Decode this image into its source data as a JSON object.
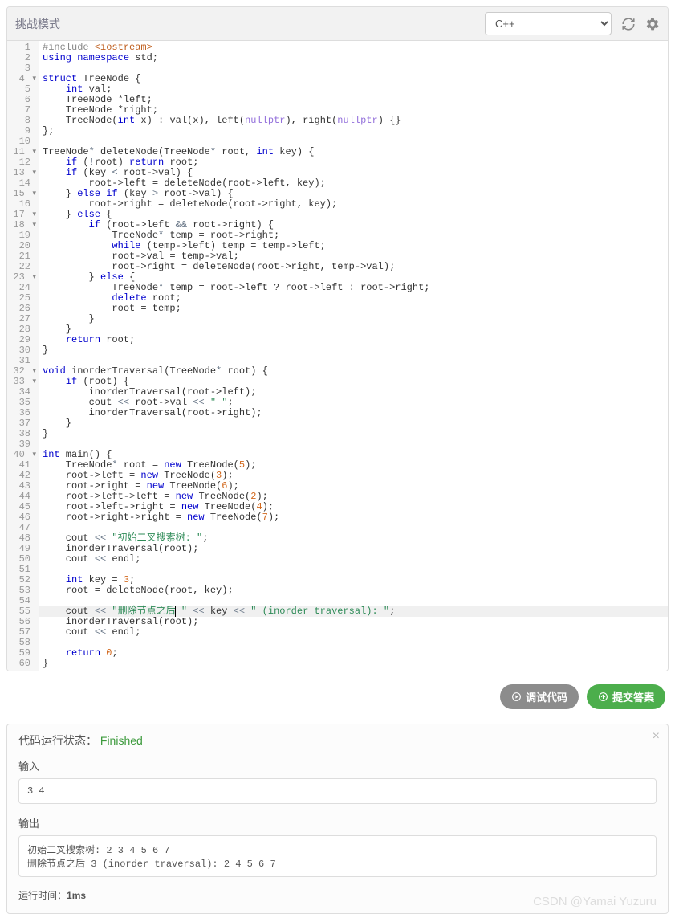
{
  "header": {
    "mode_label": "挑战模式",
    "language": "C++"
  },
  "gutter": {
    "fold_lines": [
      4,
      11,
      13,
      15,
      17,
      18,
      23,
      32,
      33,
      40
    ]
  },
  "code_lines": [
    {
      "n": 1,
      "html": "<span class='tok-pre'>#include </span><span class='tok-inc'>&lt;iostream&gt;</span>"
    },
    {
      "n": 2,
      "html": "<span class='tok-kw'>using</span> <span class='tok-kw'>namespace</span> std;"
    },
    {
      "n": 3,
      "html": ""
    },
    {
      "n": 4,
      "html": "<span class='tok-kw'>struct</span> TreeNode {"
    },
    {
      "n": 5,
      "html": "    <span class='tok-kw'>int</span> val;"
    },
    {
      "n": 6,
      "html": "    TreeNode *left;"
    },
    {
      "n": 7,
      "html": "    TreeNode *right;"
    },
    {
      "n": 8,
      "html": "    TreeNode(<span class='tok-kw'>int</span> x) : val(x), left(<span class='tok-const'>nullptr</span>), right(<span class='tok-const'>nullptr</span>) {}"
    },
    {
      "n": 9,
      "html": "};"
    },
    {
      "n": 10,
      "html": ""
    },
    {
      "n": 11,
      "html": "TreeNode<span class='tok-op'>*</span> deleteNode(TreeNode<span class='tok-op'>*</span> root, <span class='tok-kw'>int</span> key) {"
    },
    {
      "n": 12,
      "html": "    <span class='tok-kw'>if</span> (<span class='tok-op'>!</span>root) <span class='tok-kw'>return</span> root;"
    },
    {
      "n": 13,
      "html": "    <span class='tok-kw'>if</span> (key <span class='tok-op'>&lt;</span> root-&gt;val) {"
    },
    {
      "n": 14,
      "html": "        root-&gt;left = deleteNode(root-&gt;left, key);"
    },
    {
      "n": 15,
      "html": "    } <span class='tok-kw'>else</span> <span class='tok-kw'>if</span> (key <span class='tok-op'>&gt;</span> root-&gt;val) {"
    },
    {
      "n": 16,
      "html": "        root-&gt;right = deleteNode(root-&gt;right, key);"
    },
    {
      "n": 17,
      "html": "    } <span class='tok-kw'>else</span> {"
    },
    {
      "n": 18,
      "html": "        <span class='tok-kw'>if</span> (root-&gt;left <span class='tok-op'>&amp;&amp;</span> root-&gt;right) {"
    },
    {
      "n": 19,
      "html": "            TreeNode<span class='tok-op'>*</span> temp = root-&gt;right;"
    },
    {
      "n": 20,
      "html": "            <span class='tok-kw'>while</span> (temp-&gt;left) temp = temp-&gt;left;"
    },
    {
      "n": 21,
      "html": "            root-&gt;val = temp-&gt;val;"
    },
    {
      "n": 22,
      "html": "            root-&gt;right = deleteNode(root-&gt;right, temp-&gt;val);"
    },
    {
      "n": 23,
      "html": "        } <span class='tok-kw'>else</span> {"
    },
    {
      "n": 24,
      "html": "            TreeNode<span class='tok-op'>*</span> temp = root-&gt;left ? root-&gt;left : root-&gt;right;"
    },
    {
      "n": 25,
      "html": "            <span class='tok-kw'>delete</span> root;"
    },
    {
      "n": 26,
      "html": "            root = temp;"
    },
    {
      "n": 27,
      "html": "        }"
    },
    {
      "n": 28,
      "html": "    }"
    },
    {
      "n": 29,
      "html": "    <span class='tok-kw'>return</span> root;"
    },
    {
      "n": 30,
      "html": "}"
    },
    {
      "n": 31,
      "html": ""
    },
    {
      "n": 32,
      "html": "<span class='tok-kw'>void</span> inorderTraversal(TreeNode<span class='tok-op'>*</span> root) {"
    },
    {
      "n": 33,
      "html": "    <span class='tok-kw'>if</span> (root) {"
    },
    {
      "n": 34,
      "html": "        inorderTraversal(root-&gt;left);"
    },
    {
      "n": 35,
      "html": "        cout <span class='tok-op'>&lt;&lt;</span> root-&gt;val <span class='tok-op'>&lt;&lt;</span> <span class='tok-str'>\" \"</span>;"
    },
    {
      "n": 36,
      "html": "        inorderTraversal(root-&gt;right);"
    },
    {
      "n": 37,
      "html": "    }"
    },
    {
      "n": 38,
      "html": "}"
    },
    {
      "n": 39,
      "html": ""
    },
    {
      "n": 40,
      "html": "<span class='tok-kw'>int</span> main() {"
    },
    {
      "n": 41,
      "html": "    TreeNode<span class='tok-op'>*</span> root = <span class='tok-kw'>new</span> TreeNode(<span class='tok-num'>5</span>);"
    },
    {
      "n": 42,
      "html": "    root-&gt;left = <span class='tok-kw'>new</span> TreeNode(<span class='tok-num'>3</span>);"
    },
    {
      "n": 43,
      "html": "    root-&gt;right = <span class='tok-kw'>new</span> TreeNode(<span class='tok-num'>6</span>);"
    },
    {
      "n": 44,
      "html": "    root-&gt;left-&gt;left = <span class='tok-kw'>new</span> TreeNode(<span class='tok-num'>2</span>);"
    },
    {
      "n": 45,
      "html": "    root-&gt;left-&gt;right = <span class='tok-kw'>new</span> TreeNode(<span class='tok-num'>4</span>);"
    },
    {
      "n": 46,
      "html": "    root-&gt;right-&gt;right = <span class='tok-kw'>new</span> TreeNode(<span class='tok-num'>7</span>);"
    },
    {
      "n": 47,
      "html": ""
    },
    {
      "n": 48,
      "html": "    cout <span class='tok-op'>&lt;&lt;</span> <span class='tok-str'>\"初始二叉搜索树: \"</span>;"
    },
    {
      "n": 49,
      "html": "    inorderTraversal(root);"
    },
    {
      "n": 50,
      "html": "    cout <span class='tok-op'>&lt;&lt;</span> endl;"
    },
    {
      "n": 51,
      "html": ""
    },
    {
      "n": 52,
      "html": "    <span class='tok-kw'>int</span> key = <span class='tok-num'>3</span>;"
    },
    {
      "n": 53,
      "html": "    root = deleteNode(root, key);"
    },
    {
      "n": 54,
      "html": ""
    },
    {
      "n": 55,
      "hl": true,
      "html": "    cout <span class='tok-op'>&lt;&lt;</span> <span class='tok-str'>\"删除节点之后<span class='cursor'></span> \"</span> <span class='tok-op'>&lt;&lt;</span> key <span class='tok-op'>&lt;&lt;</span> <span class='tok-str'>\" (inorder traversal): \"</span>;"
    },
    {
      "n": 56,
      "html": "    inorderTraversal(root);"
    },
    {
      "n": 57,
      "html": "    cout <span class='tok-op'>&lt;&lt;</span> endl;"
    },
    {
      "n": 58,
      "html": ""
    },
    {
      "n": 59,
      "html": "    <span class='tok-kw'>return</span> <span class='tok-num'>0</span>;"
    },
    {
      "n": 60,
      "html": "}"
    }
  ],
  "actions": {
    "debug_label": "调试代码",
    "submit_label": "提交答案"
  },
  "result": {
    "status_label": "代码运行状态：",
    "status_value": "Finished",
    "input_label": "输入",
    "input_value": "3 4",
    "output_label": "输出",
    "output_value": "初始二叉搜索树: 2 3 4 5 6 7 \n删除节点之后 3 (inorder traversal): 2 4 5 6 7 ",
    "runtime_label": "运行时间：",
    "runtime_value": "1ms"
  },
  "watermark": "CSDN @Yamai Yuzuru"
}
